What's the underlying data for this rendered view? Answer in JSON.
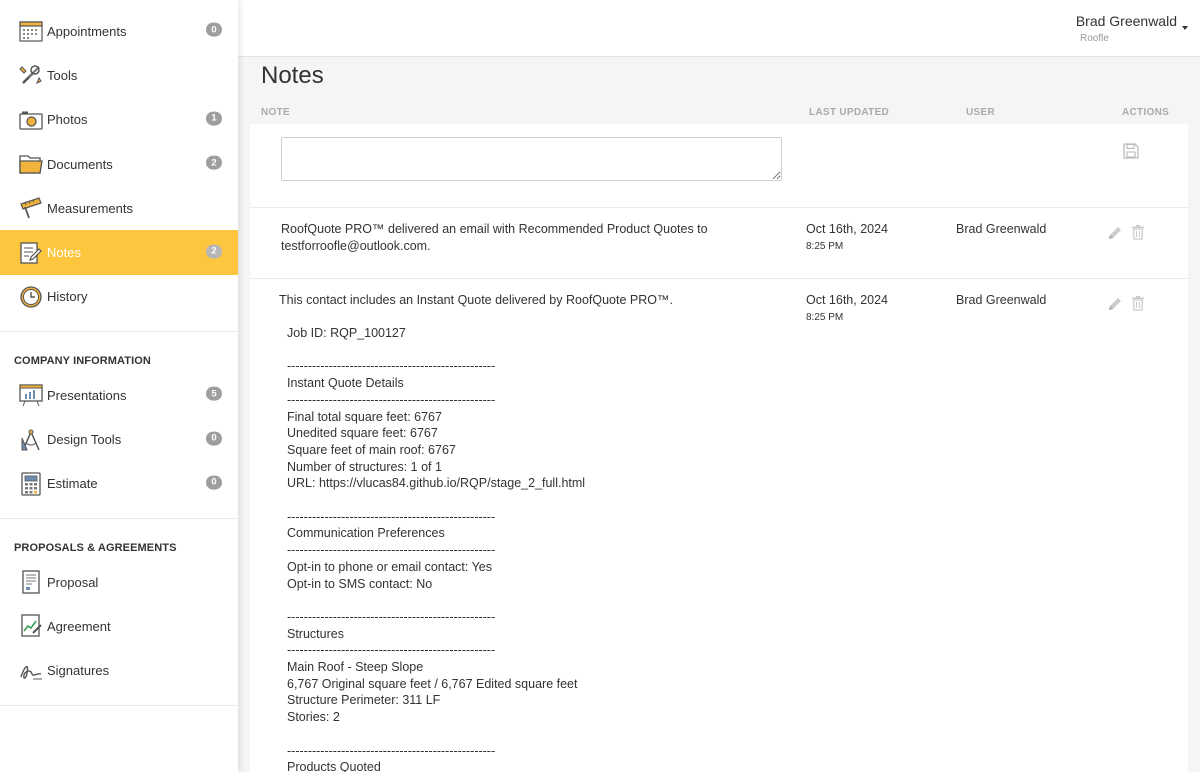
{
  "sidebar": {
    "items": [
      {
        "label": "Appointments",
        "badge": "0",
        "icon": "calendar-icon"
      },
      {
        "label": "Tools",
        "badge": null,
        "icon": "tools-icon"
      },
      {
        "label": "Photos",
        "badge": "1",
        "icon": "camera-icon"
      },
      {
        "label": "Documents",
        "badge": "2",
        "icon": "folder-icon"
      },
      {
        "label": "Measurements",
        "badge": null,
        "icon": "ruler-icon"
      },
      {
        "label": "Notes",
        "badge": "2",
        "icon": "notepad-icon",
        "active": true
      },
      {
        "label": "History",
        "badge": null,
        "icon": "clock-icon"
      }
    ],
    "company_section": {
      "title": "COMPANY INFORMATION",
      "items": [
        {
          "label": "Presentations",
          "badge": "5",
          "icon": "presentation-board-icon"
        },
        {
          "label": "Design Tools",
          "badge": "0",
          "icon": "compass-icon"
        },
        {
          "label": "Estimate",
          "badge": "0",
          "icon": "calculator-icon"
        }
      ]
    },
    "proposals_section": {
      "title": "PROPOSALS & AGREEMENTS",
      "items": [
        {
          "label": "Proposal",
          "icon": "proposal-document-icon"
        },
        {
          "label": "Agreement",
          "icon": "agreement-chart-icon"
        },
        {
          "label": "Signatures",
          "icon": "signature-icon"
        }
      ]
    }
  },
  "header": {
    "user_name": "Brad Greenwald",
    "company": "Roofle"
  },
  "main": {
    "title": "Notes",
    "columns": {
      "note": "NOTE",
      "last_updated": "LAST UPDATED",
      "user": "USER",
      "actions": "ACTIONS"
    },
    "new_note": {
      "value": "",
      "placeholder": ""
    },
    "notes": [
      {
        "text_line1": "RoofQuote PRO™ delivered an email with Recommended Product Quotes to",
        "text_line2": "testforroofle@outlook.com.",
        "date": "Oct 16th, 2024",
        "time": "8:25 PM",
        "user": "Brad Greenwald"
      },
      {
        "text_line1": "This contact includes an Instant Quote delivered by RoofQuote PRO™.",
        "date": "Oct 16th, 2024",
        "time": "8:25 PM",
        "user": "Brad Greenwald",
        "body": "Job ID: RQP_100127\n\n--------------------------------------------------\nInstant Quote Details\n--------------------------------------------------\nFinal total square feet: 6767\nUnedited square feet: 6767\nSquare feet of main roof: 6767\nNumber of structures: 1 of 1\nURL: https://vlucas84.github.io/RQP/stage_2_full.html\n\n--------------------------------------------------\nCommunication Preferences\n--------------------------------------------------\nOpt-in to phone or email contact: Yes\nOpt-in to SMS contact: No\n\n--------------------------------------------------\nStructures\n--------------------------------------------------\nMain Roof - Steep Slope\n6,767 Original square feet / 6,767 Edited square feet\nStructure Perimeter: 311 LF\nStories: 2\n\n--------------------------------------------------\nProducts Quoted"
      }
    ]
  },
  "colors": {
    "accent": "#fec63f",
    "badge": "#9e9e9e"
  }
}
